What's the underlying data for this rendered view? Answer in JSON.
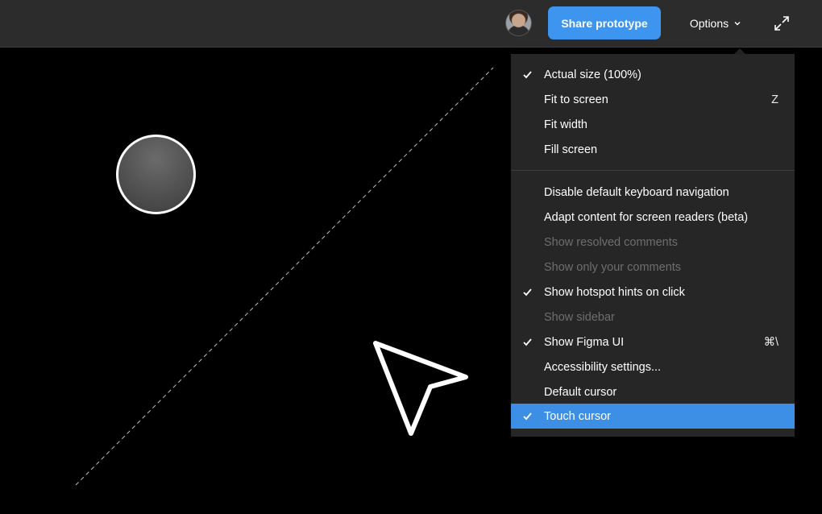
{
  "toolbar": {
    "share_label": "Share prototype",
    "options_label": "Options"
  },
  "icons": {
    "avatar": "user-avatar",
    "options_chevron": "chevron-down-icon",
    "expand": "expand-icon",
    "check": "check-icon"
  },
  "colors": {
    "toolbar_bg": "#2c2c2c",
    "accent": "#3d95f0",
    "menu_bg": "#262626",
    "selected_bg": "#3d8fe6",
    "disabled_text": "#6e6e6e",
    "canvas_bg": "#000000"
  },
  "menu": {
    "group1": [
      {
        "label": "Actual size (100%)",
        "checked": true,
        "shortcut": ""
      },
      {
        "label": "Fit to screen",
        "checked": false,
        "shortcut": "Z"
      },
      {
        "label": "Fit width",
        "checked": false,
        "shortcut": ""
      },
      {
        "label": "Fill screen",
        "checked": false,
        "shortcut": ""
      }
    ],
    "group2": [
      {
        "label": "Disable default keyboard navigation",
        "checked": false,
        "disabled": false,
        "shortcut": ""
      },
      {
        "label": "Adapt content for screen readers (beta)",
        "checked": false,
        "disabled": false,
        "shortcut": ""
      },
      {
        "label": "Show resolved comments",
        "checked": false,
        "disabled": true,
        "shortcut": ""
      },
      {
        "label": "Show only your comments",
        "checked": false,
        "disabled": true,
        "shortcut": ""
      },
      {
        "label": "Show hotspot hints on click",
        "checked": true,
        "disabled": false,
        "shortcut": ""
      },
      {
        "label": "Show sidebar",
        "checked": false,
        "disabled": true,
        "shortcut": ""
      },
      {
        "label": "Show Figma UI",
        "checked": true,
        "disabled": false,
        "shortcut": "⌘\\"
      },
      {
        "label": "Accessibility settings...",
        "checked": false,
        "disabled": false,
        "shortcut": ""
      },
      {
        "label": "Default cursor",
        "checked": false,
        "disabled": false,
        "shortcut": ""
      },
      {
        "label": "Touch cursor",
        "checked": true,
        "disabled": false,
        "selected": true,
        "shortcut": ""
      }
    ]
  }
}
